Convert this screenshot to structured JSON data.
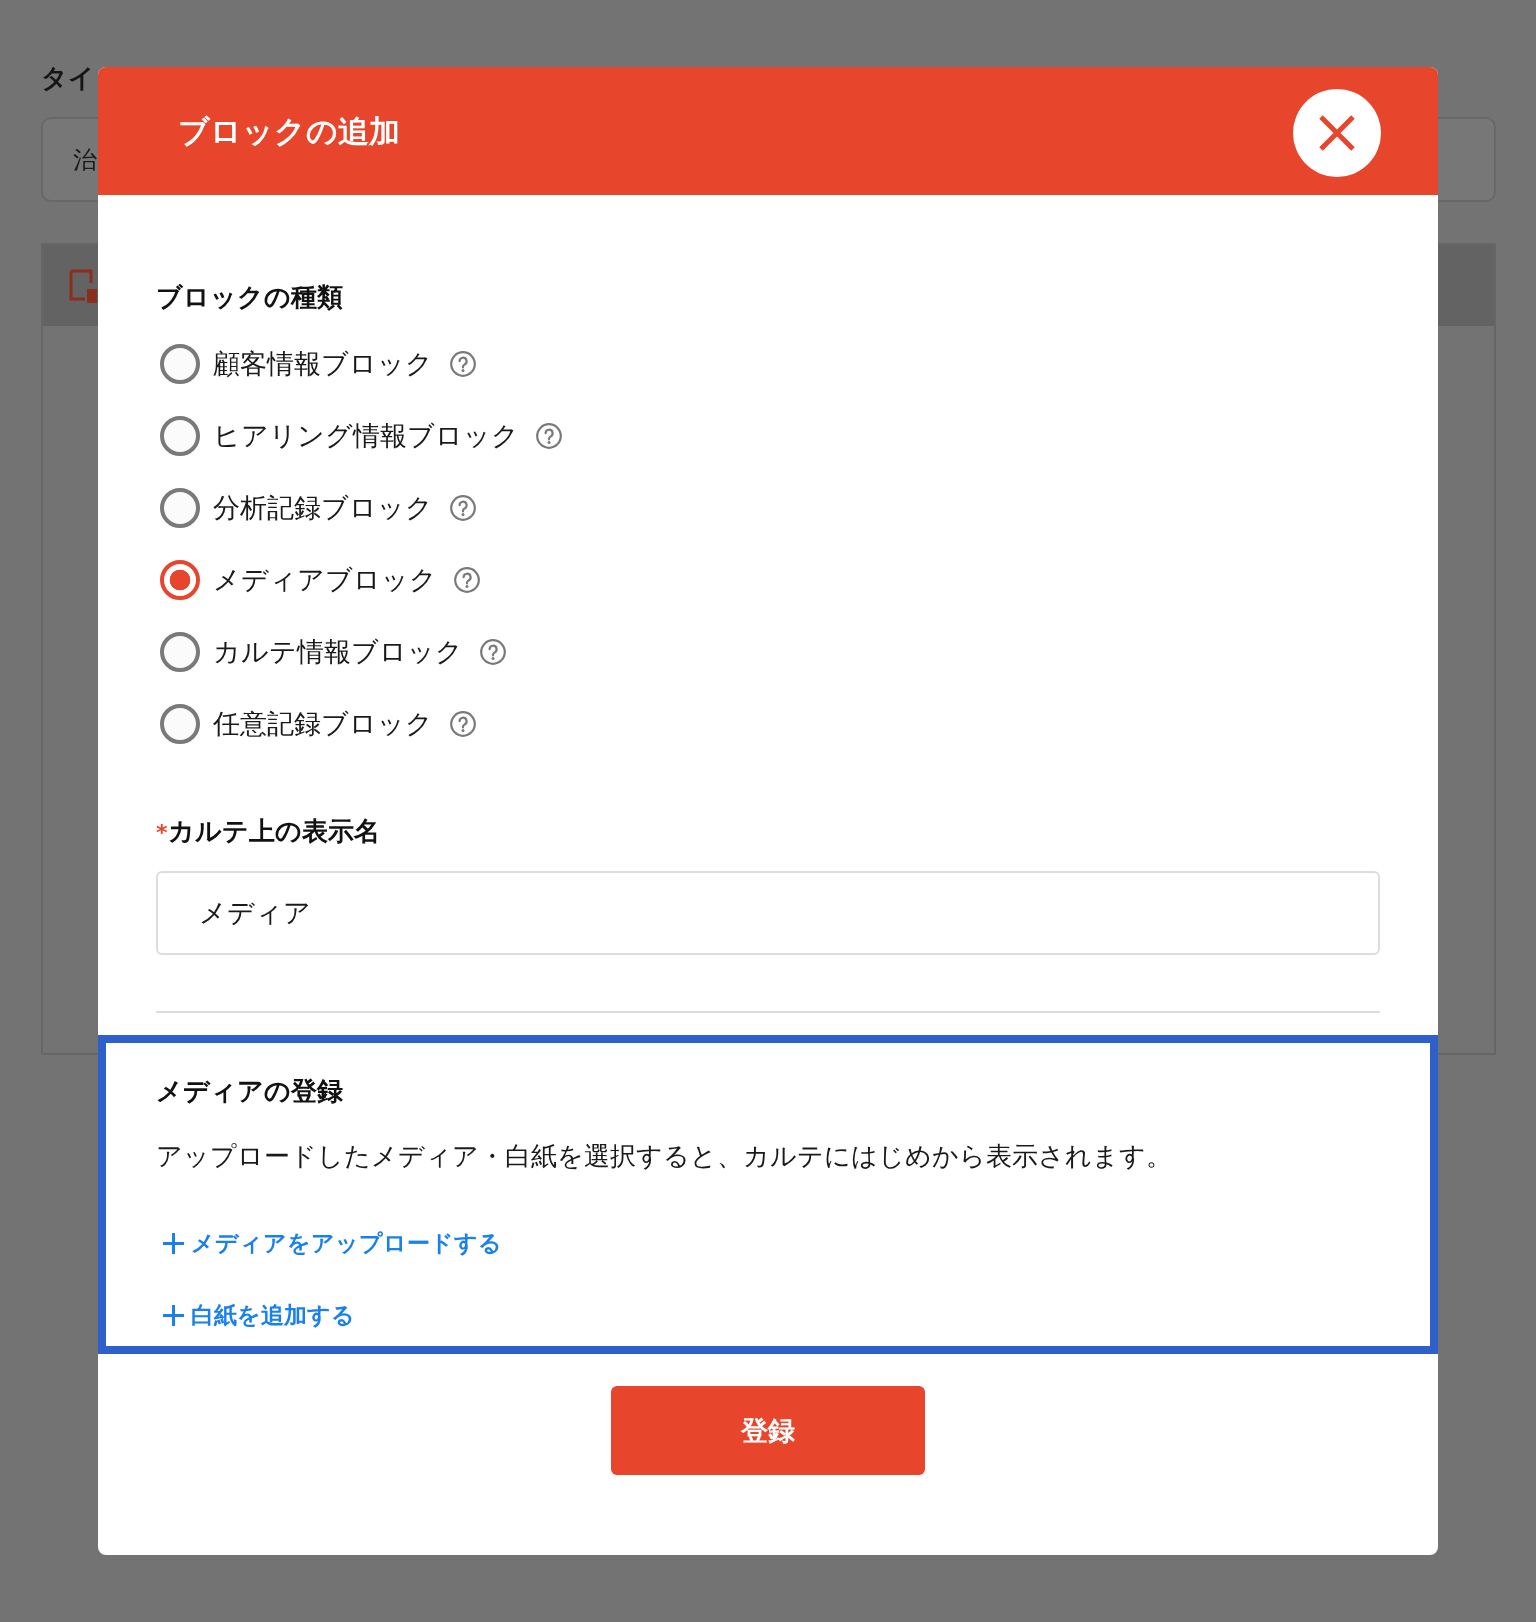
{
  "background_page": {
    "label": "タイ",
    "field": {
      "value": "治"
    }
  },
  "dialog": {
    "title": "ブロックの追加",
    "block_type": {
      "heading": "ブロックの種類",
      "options": [
        {
          "label": "顧客情報ブロック",
          "selected": false
        },
        {
          "label": "ヒアリング情報ブロック",
          "selected": false
        },
        {
          "label": "分析記録ブロック",
          "selected": false
        },
        {
          "label": "メディアブロック",
          "selected": true
        },
        {
          "label": "カルテ情報ブロック",
          "selected": false
        },
        {
          "label": "任意記録ブロック",
          "selected": false
        }
      ]
    },
    "display_name": {
      "required_mark": "*",
      "label": "カルテ上の表示名",
      "value": "メディア"
    },
    "media_section": {
      "heading": "メディアの登録",
      "description": "アップロードしたメディア・白紙を選択すると、カルテにはじめから表示されます。",
      "links": [
        "メディアをアップロードする",
        "白紙を追加する"
      ]
    },
    "submit_button": "登録"
  }
}
